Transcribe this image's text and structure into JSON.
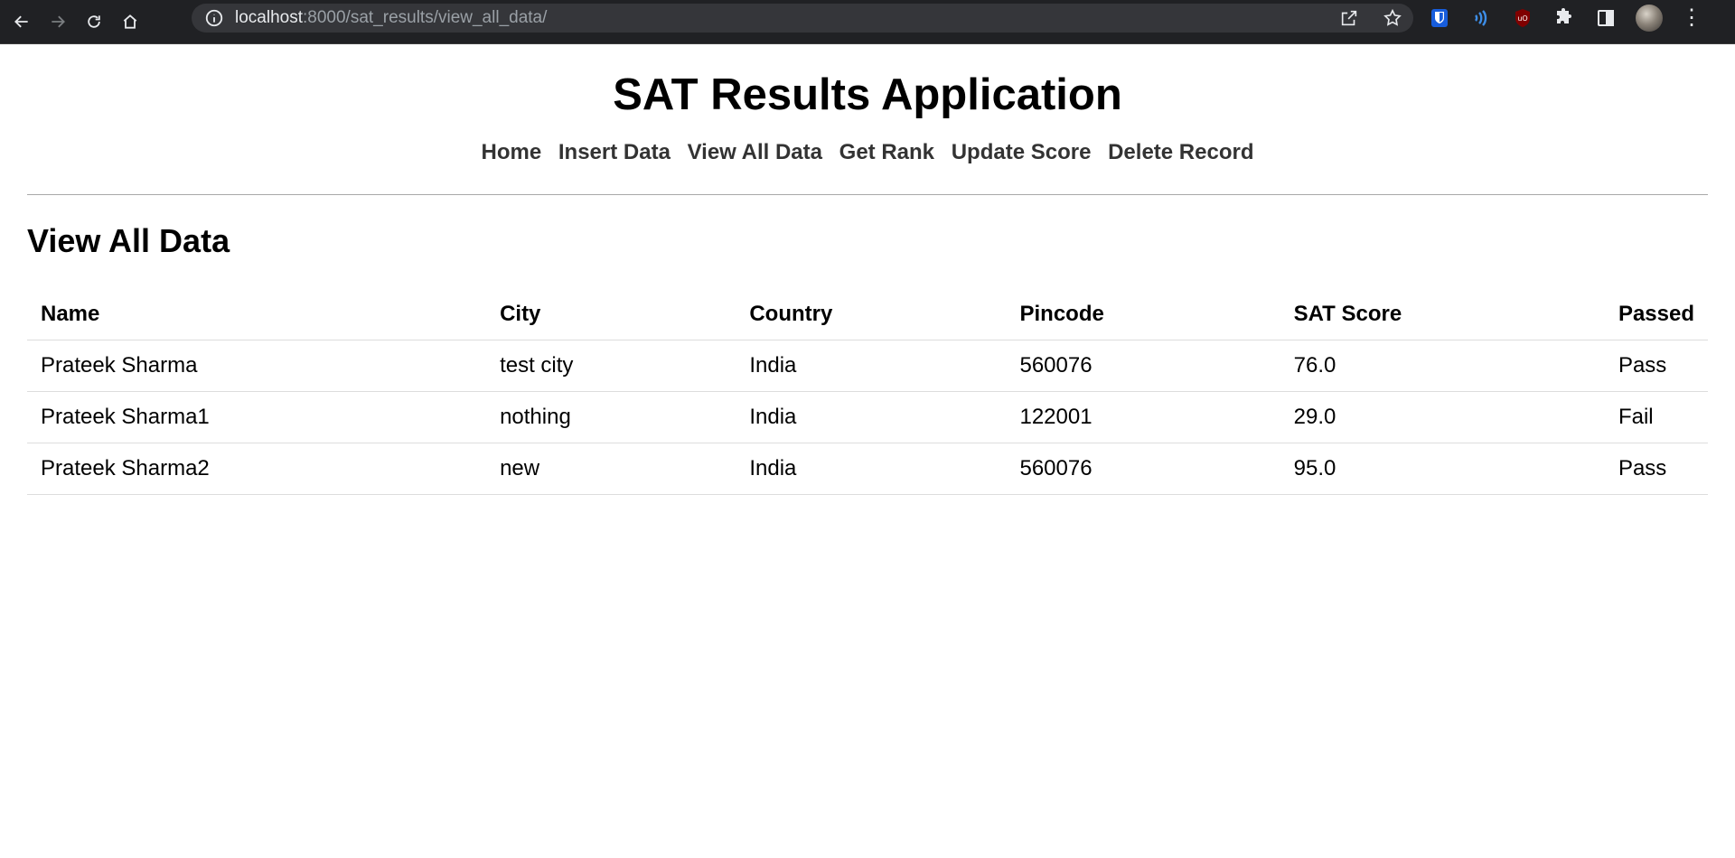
{
  "browser": {
    "url_host": "localhost",
    "url_rest": ":8000/sat_results/view_all_data/"
  },
  "header": {
    "title": "SAT Results Application"
  },
  "nav": {
    "items": [
      "Home",
      "Insert Data",
      "View All Data",
      "Get Rank",
      "Update Score",
      "Delete Record"
    ]
  },
  "main": {
    "section_title": "View All Data",
    "table": {
      "columns": [
        "Name",
        "City",
        "Country",
        "Pincode",
        "SAT Score",
        "Passed"
      ],
      "rows": [
        [
          "Prateek Sharma",
          "test city",
          "India",
          "560076",
          "76.0",
          "Pass"
        ],
        [
          "Prateek Sharma1",
          "nothing",
          "India",
          "122001",
          "29.0",
          "Fail"
        ],
        [
          "Prateek Sharma2",
          "new",
          "India",
          "560076",
          "95.0",
          "Pass"
        ]
      ]
    }
  }
}
